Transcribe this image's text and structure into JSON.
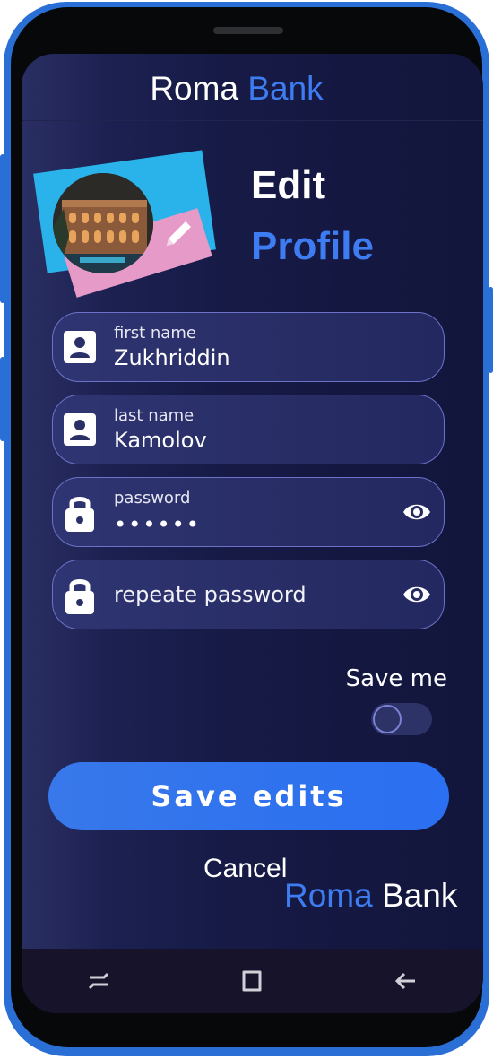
{
  "header": {
    "brand_first": "Roma",
    "brand_second": "Bank"
  },
  "title": {
    "line1": "Edit",
    "line2": "Profile"
  },
  "form": {
    "first_name": {
      "label": "first name",
      "value": "Zukhriddin"
    },
    "last_name": {
      "label": "last name",
      "value": "Kamolov"
    },
    "password": {
      "label": "password",
      "value": "••••••"
    },
    "repeat_password": {
      "placeholder": "repeate password"
    }
  },
  "save_me": {
    "label": "Save me",
    "checked": false
  },
  "buttons": {
    "save": "Save edits",
    "cancel": "Cancel"
  },
  "footer": {
    "brand_first": "Roma",
    "brand_second": "Bank"
  },
  "icons": {
    "person": "person-card-icon",
    "lock": "lock-icon",
    "eye": "eye-icon",
    "edit": "pencil-icon",
    "nav_recent": "recent-apps-icon",
    "nav_home": "home-icon",
    "nav_back": "back-arrow-icon"
  },
  "colors": {
    "accent": "#3d7cf1",
    "background": "#161a45",
    "field_border": "#6c72c8",
    "save_button": "#2f72ee"
  }
}
